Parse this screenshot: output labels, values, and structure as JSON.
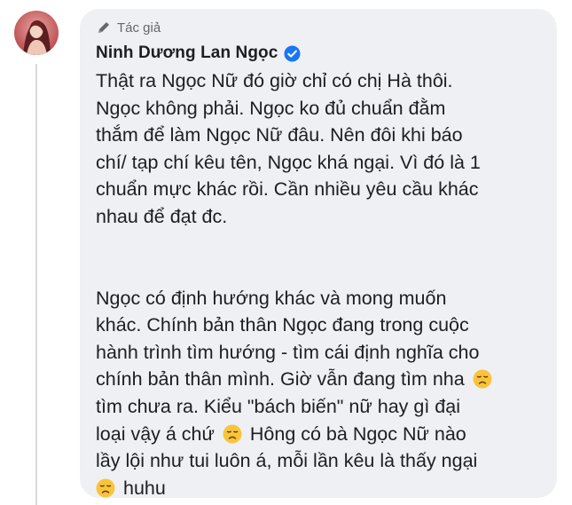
{
  "comment": {
    "author_badge": "Tác giả",
    "author_name": "Ninh Dương Lan Ngọc",
    "author_verified": true,
    "badge_icon": "pen-icon",
    "emoji_name": "disappointed-face-emoji",
    "paragraph1": [
      "Thật ra Ngọc Nữ đó giờ chỉ có chị Hà thôi.",
      "Ngọc không phải. Ngọc ko đủ chuẩn đằm",
      "thắm để làm Ngọc Nữ đâu. Nên đôi khi báo",
      "chí/ tạp chí kêu tên, Ngọc khá ngại. Vì đó là 1",
      "chuẩn mực khác rồi. Cần nhiều yêu cầu khác",
      "nhau để đạt đc."
    ],
    "paragraph2": {
      "line1": "Ngọc có định hướng khác và mong muốn",
      "line2": "khác. Chính bản thân Ngọc đang trong cuộc",
      "line3": "hành trình tìm hướng - tìm cái định nghĩa cho",
      "line4": "chính bản thân mình. Giờ vẫn đang tìm nha",
      "line5": "tìm chưa ra. Kiểu \"bách biến\" nữ hay gì đại",
      "line6a": "loại vậy á chứ",
      "line6b": "Hông có bà Ngọc Nữ nào",
      "line7": "lầy lội như tui luôn á, mỗi lần kêu là thấy ngại",
      "line8": "huhu"
    }
  }
}
